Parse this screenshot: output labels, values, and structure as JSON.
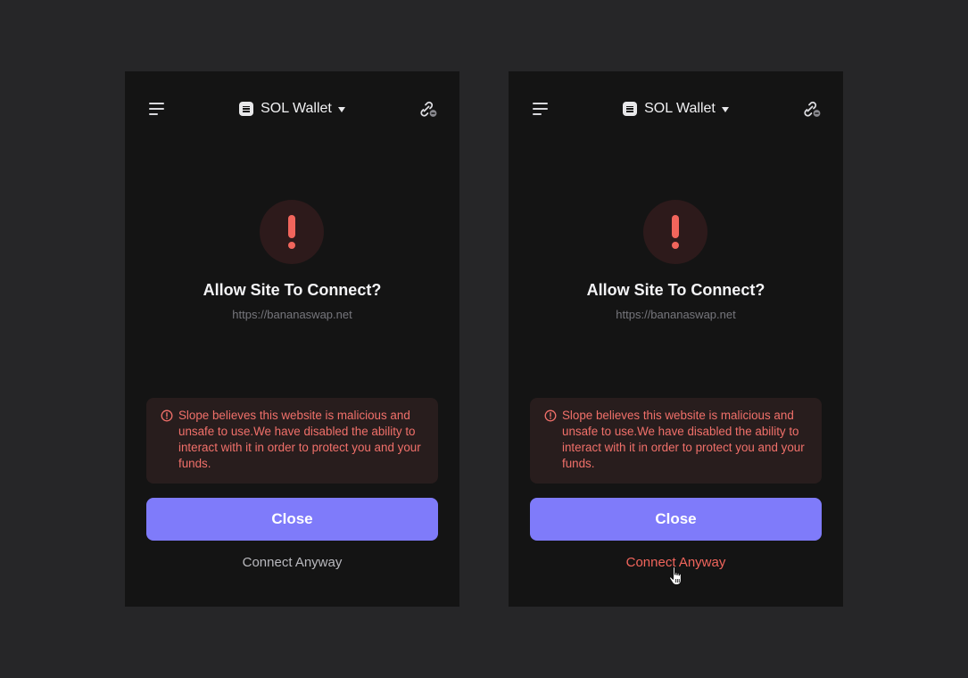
{
  "colors": {
    "page_background": "#262628",
    "panel_background": "#141414",
    "accent_button": "#7f7bfa",
    "danger": "#f1655c",
    "danger_bg": "#2d1a1b",
    "warning_box_bg": "#281d1d",
    "muted_text": "#76767c",
    "connect_idle": "#b9b9be",
    "connect_hover": "#f1655c"
  },
  "panels": [
    {
      "state": "default",
      "header": {
        "menu_icon": "menu-icon",
        "wallet_name": "SOL Wallet",
        "wallet_logo_icon": "slope-logo-icon",
        "dropdown_icon": "caret-down-icon",
        "connection_icon": "link-disconnected-icon"
      },
      "alert_icon": "exclamation-icon",
      "title": "Allow Site To Connect?",
      "site_url": "https://bananaswap.net",
      "warning": {
        "icon": "alert-circle-icon",
        "text": "Slope believes this website is malicious and unsafe to use.We have disabled the ability to interact with it in order to protect you and your funds."
      },
      "close_label": "Close",
      "connect_label": "Connect Anyway"
    },
    {
      "state": "hover-connect",
      "header": {
        "menu_icon": "menu-icon",
        "wallet_name": "SOL Wallet",
        "wallet_logo_icon": "slope-logo-icon",
        "dropdown_icon": "caret-down-icon",
        "connection_icon": "link-disconnected-icon"
      },
      "alert_icon": "exclamation-icon",
      "title": "Allow Site To Connect?",
      "site_url": "https://bananaswap.net",
      "warning": {
        "icon": "alert-circle-icon",
        "text": "Slope believes this website is malicious and unsafe to use.We have disabled the ability to interact with it in order to protect you and your funds."
      },
      "close_label": "Close",
      "connect_label": "Connect Anyway",
      "cursor_icon": "hand-pointer-icon"
    }
  ]
}
